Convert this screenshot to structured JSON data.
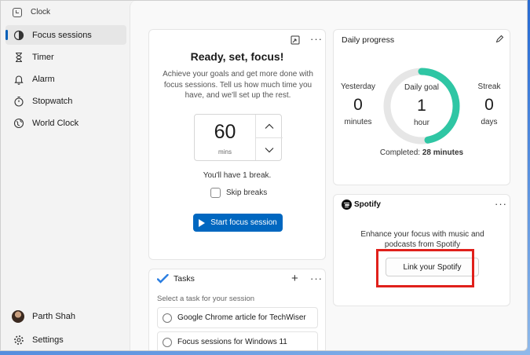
{
  "window": {
    "app_title": "Clock",
    "controls": {
      "minimize": "–",
      "maximize": "☐",
      "close": "✕"
    }
  },
  "sidebar": {
    "items": [
      {
        "label": "Focus sessions",
        "icon": "focus-icon",
        "active": true
      },
      {
        "label": "Timer",
        "icon": "hourglass-icon"
      },
      {
        "label": "Alarm",
        "icon": "bell-icon"
      },
      {
        "label": "Stopwatch",
        "icon": "stopwatch-icon"
      },
      {
        "label": "World Clock",
        "icon": "globe-icon"
      }
    ],
    "user_name": "Parth Shah",
    "settings_label": "Settings"
  },
  "focus": {
    "title": "Ready, set, focus!",
    "description": "Achieve your goals and get more done with focus sessions. Tell us how much time you have, and we'll set up the rest.",
    "minutes_value": "60",
    "minutes_unit": "mins",
    "break_text": "You'll have 1 break.",
    "skip_breaks_label": "Skip breaks",
    "start_button": "Start focus session",
    "more": "···"
  },
  "progress": {
    "title": "Daily progress",
    "yesterday": {
      "label": "Yesterday",
      "value": "0",
      "unit": "minutes"
    },
    "goal": {
      "label": "Daily goal",
      "value": "1",
      "unit": "hour"
    },
    "streak": {
      "label": "Streak",
      "value": "0",
      "unit": "days"
    },
    "completed_label": "Completed:",
    "completed_value": "28 minutes",
    "completed_fraction": 0.47,
    "accent": "#2fc6a4"
  },
  "spotify": {
    "brand": "Spotify",
    "description": "Enhance your focus with music and podcasts from Spotify",
    "link_button": "Link your Spotify",
    "more": "···",
    "highlight_color": "#e0201b"
  },
  "tasks": {
    "title": "Tasks",
    "hint": "Select a task for your session",
    "items": [
      "Google Chrome article for TechWiser",
      "Focus sessions for Windows 11"
    ],
    "add": "+",
    "more": "···"
  }
}
